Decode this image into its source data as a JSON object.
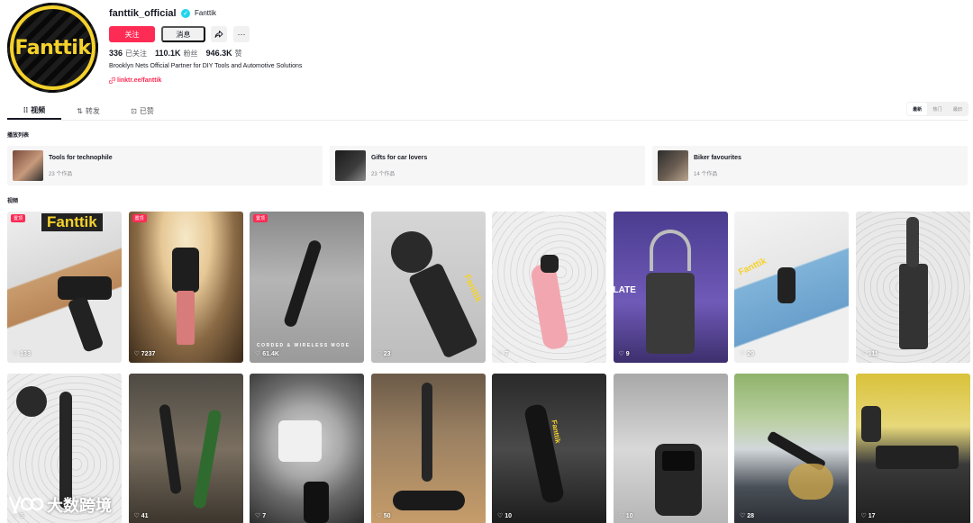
{
  "profile": {
    "username": "fanttik_official",
    "nickname": "Fanttik",
    "avatar_logo": "Fanttik",
    "follow_label": "关注",
    "message_label": "消息",
    "stats": [
      {
        "value": "336",
        "label": "已关注"
      },
      {
        "value": "110.1K",
        "label": "粉丝"
      },
      {
        "value": "946.3K",
        "label": "赞"
      }
    ],
    "bio": "Brooklyn Nets Official Partner for DIY Tools and Automotive Solutions",
    "link": "linktr.ee/fanttik"
  },
  "tabs": [
    {
      "label": "视频",
      "icon": "grid-icon",
      "active": true
    },
    {
      "label": "转发",
      "icon": "repost-icon",
      "active": false
    },
    {
      "label": "已赞",
      "icon": "liked-icon",
      "active": false
    }
  ],
  "sort_options": [
    "最新",
    "热门",
    "最旧"
  ],
  "sections": {
    "playlists": "播放列表",
    "videos": "视频"
  },
  "playlists": [
    {
      "title": "Tools for technophile",
      "count": "23 个作品"
    },
    {
      "title": "Gifts for car lovers",
      "count": "23 个作品"
    },
    {
      "title": "Biker favourites",
      "count": "14 个作品"
    }
  ],
  "pinned_label": "置顶",
  "videos": [
    {
      "likes": "133",
      "pinned": true,
      "overlay": "Fanttik"
    },
    {
      "likes": "7237",
      "pinned": true,
      "overlay": ""
    },
    {
      "likes": "61.4K",
      "pinned": true,
      "overlay": "CORDED & WIRELESS MODE"
    },
    {
      "likes": "23",
      "pinned": false,
      "overlay": "Fanttik"
    },
    {
      "likes": "7",
      "pinned": false,
      "overlay": ""
    },
    {
      "likes": "9",
      "pinned": false,
      "overlay": "LATE"
    },
    {
      "likes": "29",
      "pinned": false,
      "overlay": "Fanttik"
    },
    {
      "likes": "111",
      "pinned": false,
      "overlay": ""
    },
    {
      "likes": "5",
      "pinned": false,
      "overlay": ""
    },
    {
      "likes": "41",
      "pinned": false,
      "overlay": ""
    },
    {
      "likes": "7",
      "pinned": false,
      "overlay": ""
    },
    {
      "likes": "50",
      "pinned": false,
      "overlay": ""
    },
    {
      "likes": "10",
      "pinned": false,
      "overlay": "Fanttik"
    },
    {
      "likes": "10",
      "pinned": false,
      "overlay": ""
    },
    {
      "likes": "28",
      "pinned": false,
      "overlay": ""
    },
    {
      "likes": "17",
      "pinned": false,
      "overlay": ""
    }
  ],
  "watermark": "大数跨境",
  "colors": {
    "accent": "#fe2c55",
    "verified": "#20d5ec",
    "brand": "#f5d22b"
  }
}
